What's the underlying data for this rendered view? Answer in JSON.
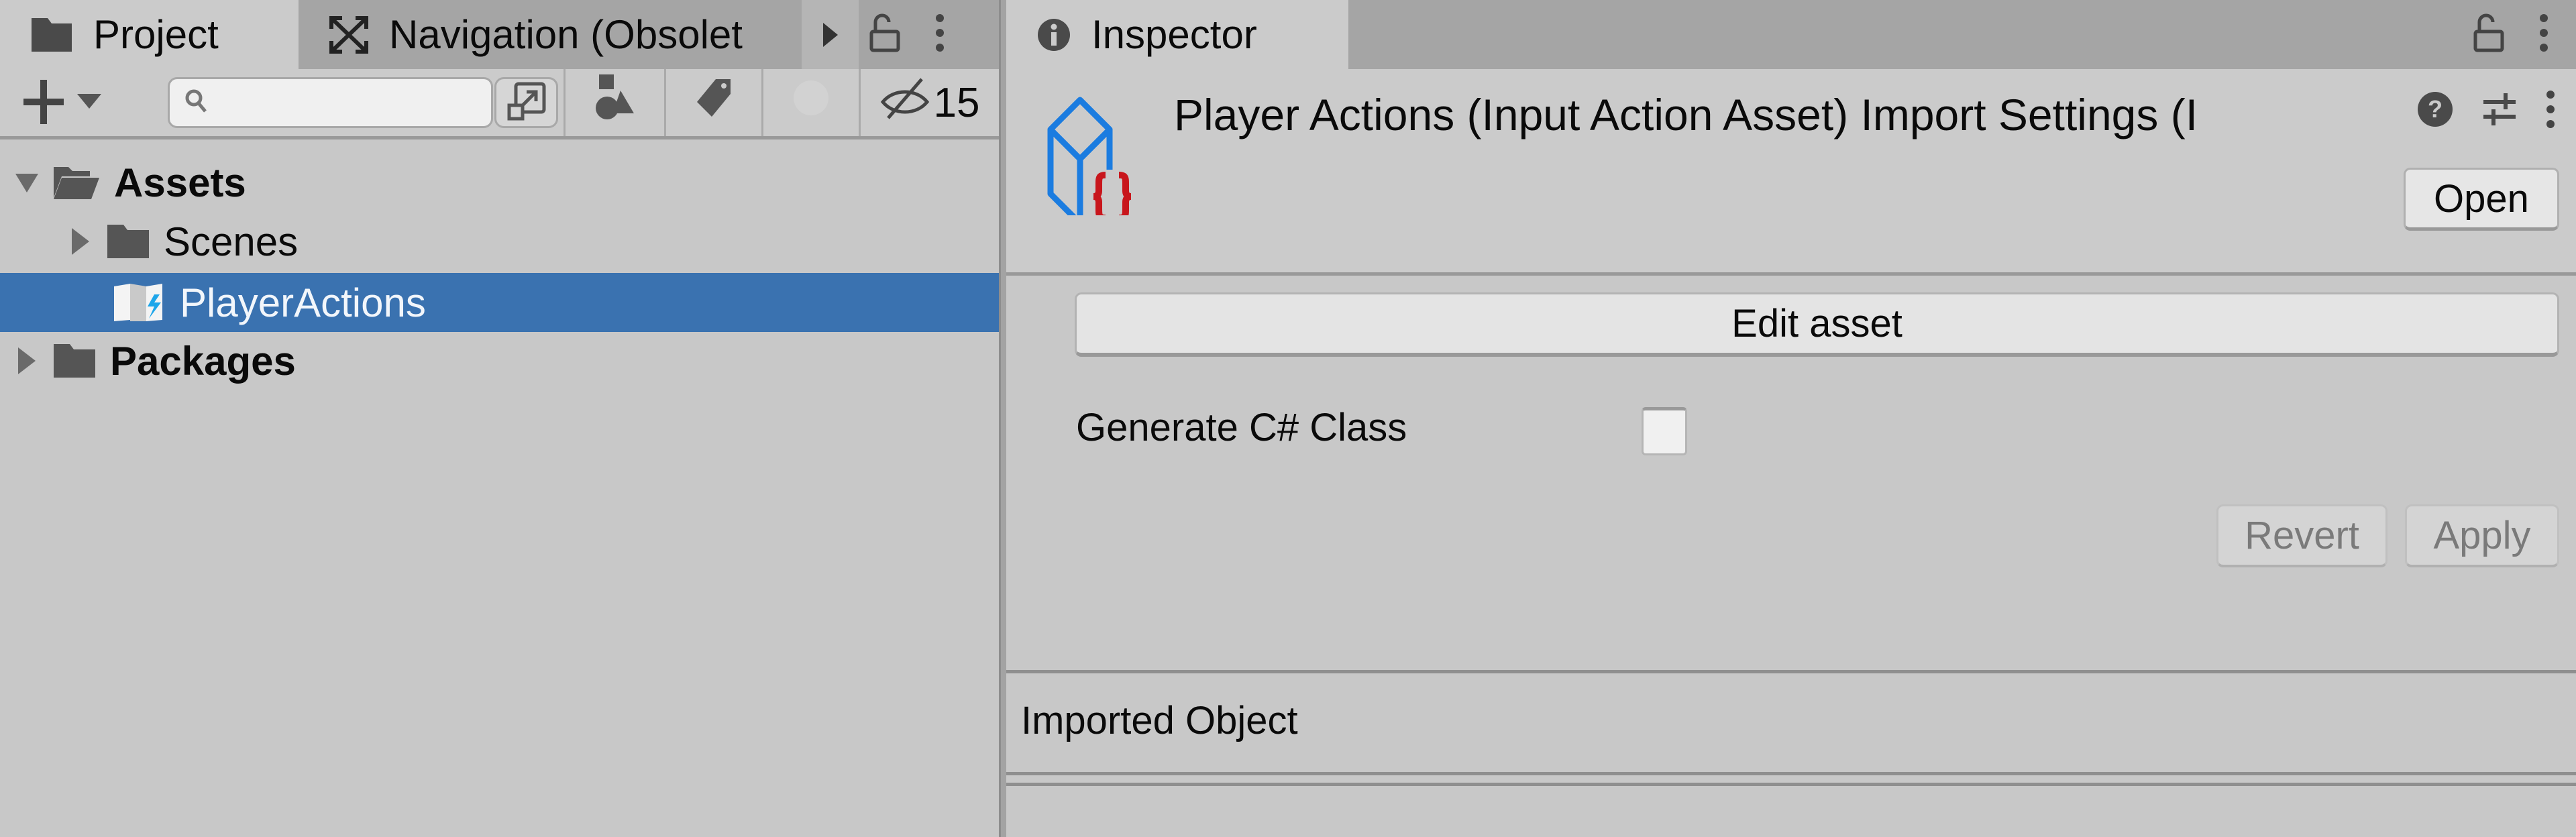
{
  "project_panel": {
    "tabs": [
      {
        "label": "Project",
        "icon": "folder-icon",
        "active": true
      },
      {
        "label": "Navigation (Obsolete)",
        "display_label": "Navigation (Obsolet",
        "icon": "navigation-icon",
        "active": false
      }
    ],
    "toolbar": {
      "search": {
        "value": "",
        "placeholder": ""
      },
      "hidden_packages_count": "15"
    },
    "tree": [
      {
        "label": "Assets",
        "expanded": true,
        "bold": true,
        "depth": 0,
        "icon": "folder-open-icon"
      },
      {
        "label": "Scenes",
        "expanded": false,
        "bold": false,
        "depth": 1,
        "icon": "folder-icon"
      },
      {
        "label": "PlayerActions",
        "selected": true,
        "depth": 1,
        "icon": "input-action-asset-icon"
      },
      {
        "label": "Packages",
        "expanded": false,
        "bold": true,
        "depth": 0,
        "icon": "folder-icon"
      }
    ]
  },
  "inspector": {
    "tab_label": "Inspector",
    "title": "Player Actions (Input Action Asset) Import Settings (I",
    "open_label": "Open",
    "edit_asset_label": "Edit asset",
    "generate_csharp": {
      "label": "Generate C# Class",
      "checked": false
    },
    "revert_label": "Revert",
    "apply_label": "Apply",
    "imported_object_label": "Imported Object"
  },
  "colors": {
    "selection": "#3a72b0",
    "asset_icon_blue": "#1b7ce0",
    "asset_icon_red": "#c8161c"
  }
}
